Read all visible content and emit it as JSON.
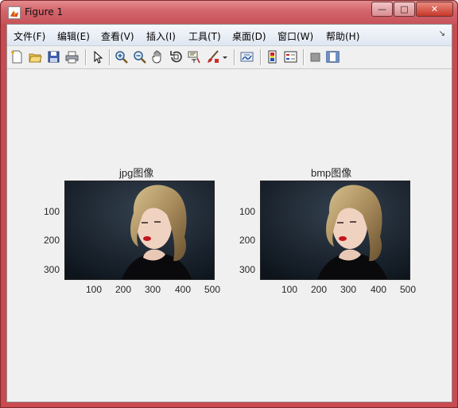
{
  "window": {
    "title": "Figure 1",
    "minimize": "—",
    "maximize": "□",
    "close": "✕"
  },
  "menu": [
    {
      "label": "文件(F)"
    },
    {
      "label": "编辑(E)"
    },
    {
      "label": "查看(V)"
    },
    {
      "label": "插入(I)"
    },
    {
      "label": "工具(T)"
    },
    {
      "label": "桌面(D)"
    },
    {
      "label": "窗口(W)"
    },
    {
      "label": "帮助(H)"
    }
  ],
  "menu_overflow": "↘",
  "toolbar": [
    "new-figure-icon",
    "open-file-icon",
    "save-icon",
    "print-icon",
    "pointer-icon",
    "zoom-in-icon",
    "zoom-out-icon",
    "pan-hand-icon",
    "rotate-3d-icon",
    "data-cursor-icon",
    "brush-icon",
    "brush-dropdown-icon",
    "link-plot-icon",
    "colorbar-icon",
    "legend-icon",
    "hide-plot-tools-icon",
    "show-plot-tools-icon"
  ],
  "axes": [
    {
      "title": "jpg图像",
      "xticks": [
        "100",
        "200",
        "300",
        "400",
        "500"
      ],
      "yticks": [
        "100",
        "200",
        "300"
      ]
    },
    {
      "title": "bmp图像",
      "xticks": [
        "100",
        "200",
        "300",
        "400",
        "500"
      ],
      "yticks": [
        "100",
        "200",
        "300"
      ]
    }
  ],
  "colors": {
    "frame": "#c94a4f",
    "figure_bg": "#f0f0f0",
    "photo_bg": "#1c2632"
  }
}
